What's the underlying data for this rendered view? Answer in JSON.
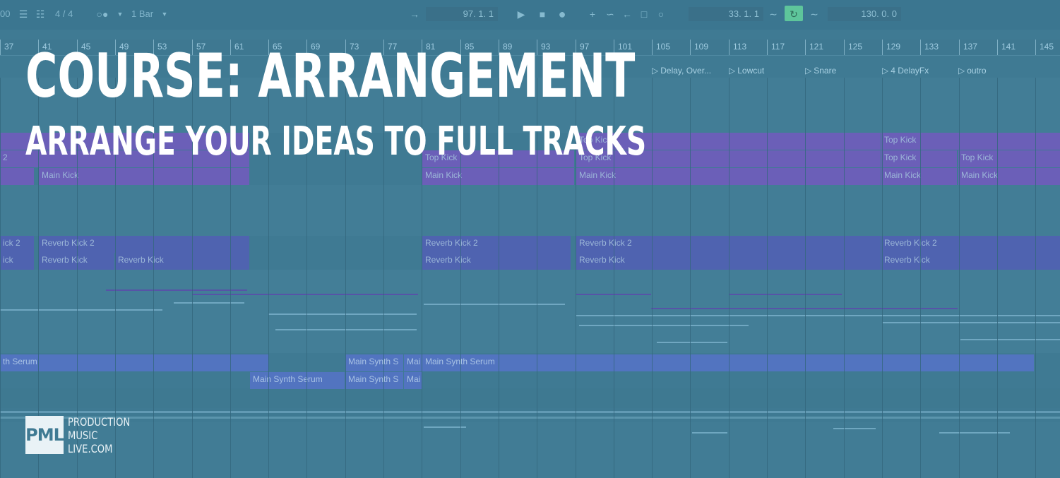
{
  "toolbar": {
    "left_value": "00",
    "time_signature": "4 / 4",
    "quantize": "1 Bar",
    "arrangement_position": "97.  1.  1",
    "loop_start": "33.  1.  1",
    "loop_length": "130.  0.  0"
  },
  "ruler": {
    "bars": [
      "37",
      "41",
      "45",
      "49",
      "53",
      "57",
      "61",
      "65",
      "69",
      "73",
      "77",
      "81",
      "85",
      "89",
      "93",
      "97",
      "101",
      "105",
      "109",
      "113",
      "117",
      "121",
      "125",
      "129",
      "133",
      "137",
      "141",
      "145"
    ]
  },
  "locators": [
    {
      "label": "Delay, Over..."
    },
    {
      "label": "Lowcut"
    },
    {
      "label": "Snare"
    },
    {
      "label": "4 DelayFx"
    },
    {
      "label": "outro"
    }
  ],
  "clips": {
    "top_kick": "Top Kick",
    "main_kick": "Main Kick",
    "reverb_kick_2": "Reverb Kick 2",
    "reverb_kick": "Reverb Kick",
    "main_synth_serum": "Main Synth Serum",
    "main_synth_s": "Main Synth S",
    "mai": "Mai",
    "th_serum": "th Serum",
    "kick_2": "2",
    "kick_frag": "ick 2",
    "ick": "ick"
  },
  "overlay": {
    "title": "COURSE: ARRANGEMENT",
    "subtitle": "ARRANGE YOUR IDEAS TO FULL TRACKS"
  },
  "logo": {
    "mark": "PML",
    "line1": "PRODUCTION",
    "line2": "MUSIC",
    "line3": "LIVE.COM"
  },
  "colors": {
    "overlay_tint": "#3f7a93",
    "clip_purple": "#6b5fb8",
    "clip_blue": "#4f63b0",
    "loop_active": "#5ec59b"
  }
}
